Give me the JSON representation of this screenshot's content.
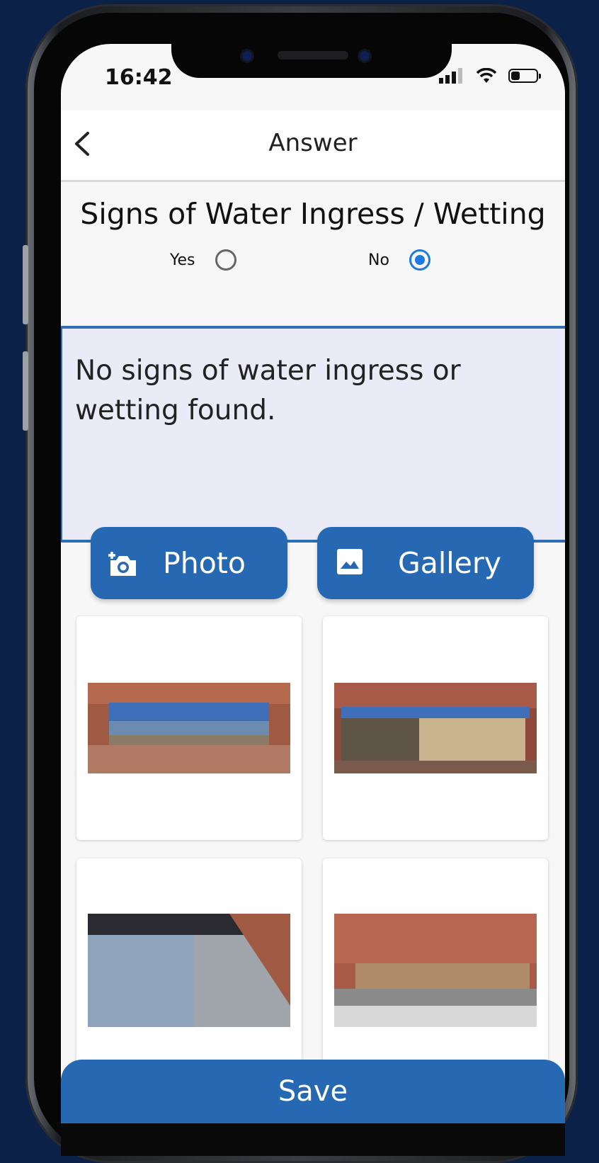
{
  "status_bar": {
    "time": "16:42"
  },
  "header": {
    "title": "Answer"
  },
  "question": {
    "title": "Signs of Water Ingress / Wetting",
    "options": [
      {
        "label": "Yes",
        "selected": false
      },
      {
        "label": "No",
        "selected": true
      }
    ]
  },
  "answer": {
    "text": "No signs of water ingress or wetting found."
  },
  "actions": {
    "photo_label": "Photo",
    "gallery_label": "Gallery"
  },
  "photos": [
    {
      "icon": "cargo-photo-1"
    },
    {
      "icon": "cargo-photo-2"
    },
    {
      "icon": "cargo-photo-3"
    },
    {
      "icon": "cargo-photo-4"
    }
  ],
  "footer": {
    "save_label": "Save"
  },
  "colors": {
    "accent": "#2668b1",
    "radio_on": "#1f7ae0",
    "answer_bg": "#ebebf8",
    "background": "#0b2148"
  }
}
